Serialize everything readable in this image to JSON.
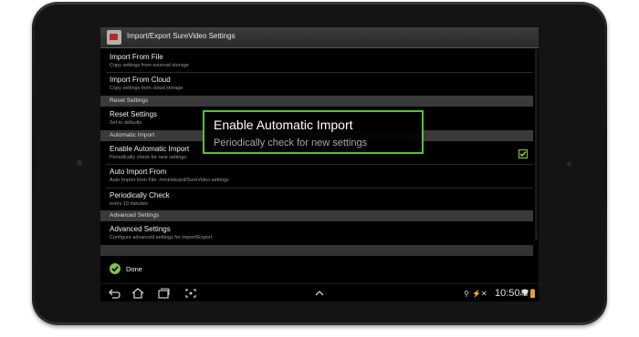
{
  "window": {
    "title": "Import/Export SureVideo Settings"
  },
  "items": {
    "import_file": {
      "title": "Import From File",
      "subtitle": "Copy settings from external storage"
    },
    "import_cloud": {
      "title": "Import From Cloud",
      "subtitle": "Copy settings from cloud storage"
    },
    "reset": {
      "title": "Reset Settings",
      "subtitle": "Set to defaults"
    },
    "enable_auto": {
      "title": "Enable Automatic Import",
      "subtitle": "Periodically check for new settings",
      "checked": true
    },
    "auto_from": {
      "title": "Auto Import From",
      "subtitle": "Auto Import from File: /mnt/sdcard/SureVideo.settings"
    },
    "periodic": {
      "title": "Periodically Check",
      "subtitle": "every 10 minutes"
    },
    "advanced": {
      "title": "Advanced Settings",
      "subtitle": "Configure advanced settings for Import/Export"
    }
  },
  "sections": {
    "reset": "Reset Settings",
    "auto": "Automatic Import",
    "advanced": "Advanced Settings"
  },
  "done": {
    "label": "Done"
  },
  "status_bar": {
    "time": "10:50",
    "ampm": "AM"
  },
  "callout": {
    "title": "Enable Automatic Import",
    "subtitle": "Periodically check for new settings"
  },
  "colors": {
    "accent_green": "#5bbf3a",
    "check_green": "#8dc63f",
    "section_bg": "#3a3a3a"
  },
  "icons": [
    "back-icon",
    "home-icon",
    "recent-apps-icon",
    "screenshot-icon",
    "chevron-up-icon",
    "usb-icon",
    "wifi-icon",
    "battery-icon",
    "check-icon"
  ]
}
